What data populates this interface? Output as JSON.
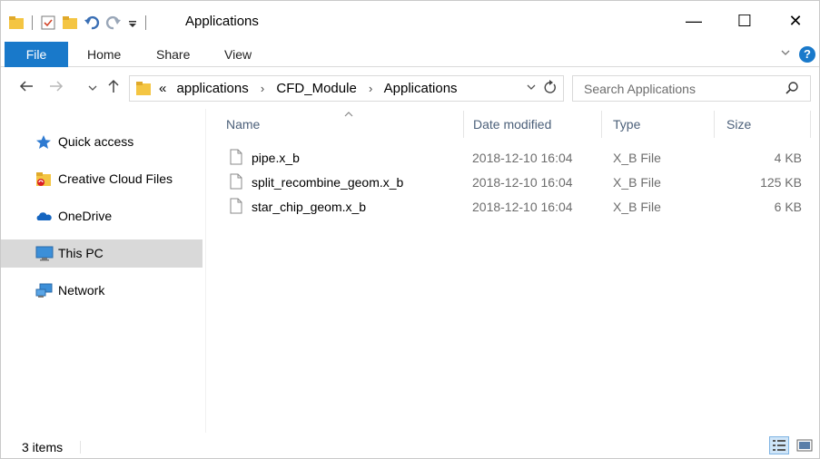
{
  "window": {
    "title": "Applications",
    "controls": {
      "minimize": "—",
      "maximize": "☐",
      "close": "✕"
    }
  },
  "ribbon": {
    "tabs": [
      {
        "label": "File",
        "active": true
      },
      {
        "label": "Home"
      },
      {
        "label": "Share"
      },
      {
        "label": "View"
      }
    ],
    "help_label": "?"
  },
  "address": {
    "overflow": "«",
    "crumbs": [
      "applications",
      "CFD_Module",
      "Applications"
    ],
    "search_placeholder": "Search Applications"
  },
  "nav_pane": {
    "items": [
      {
        "label": "Quick access",
        "icon": "star-icon"
      },
      {
        "label": "Creative Cloud Files",
        "icon": "creative-cloud-icon"
      },
      {
        "label": "OneDrive",
        "icon": "cloud-icon"
      },
      {
        "label": "This PC",
        "icon": "monitor-icon",
        "selected": true
      },
      {
        "label": "Network",
        "icon": "network-icon"
      }
    ]
  },
  "columns": {
    "name": "Name",
    "date": "Date modified",
    "type": "Type",
    "size": "Size"
  },
  "files": [
    {
      "name": "pipe.x_b",
      "date": "2018-12-10 16:04",
      "type": "X_B File",
      "size": "4 KB"
    },
    {
      "name": "split_recombine_geom.x_b",
      "date": "2018-12-10 16:04",
      "type": "X_B File",
      "size": "125 KB"
    },
    {
      "name": "star_chip_geom.x_b",
      "date": "2018-12-10 16:04",
      "type": "X_B File",
      "size": "6 KB"
    }
  ],
  "status": {
    "item_count": "3 items"
  },
  "colors": {
    "accent": "#1979ca",
    "folder": "#f4c542",
    "selection": "#d9d9d9"
  }
}
